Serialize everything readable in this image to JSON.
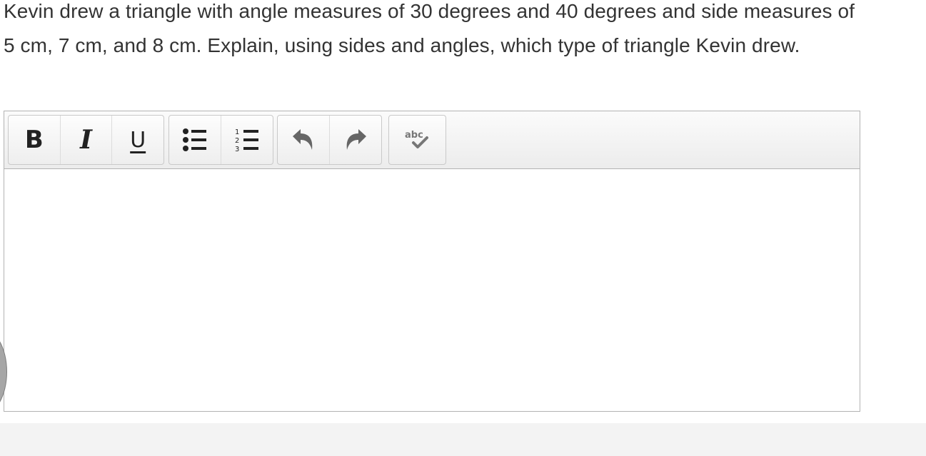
{
  "question": {
    "text": "Kevin drew a triangle with angle measures of 30 degrees and 40 degrees and side measures of 5 cm, 7 cm, and 8 cm. Explain, using sides and angles, which type of triangle Kevin drew."
  },
  "toolbar": {
    "bold_label": "B",
    "italic_label": "I",
    "underline_label": "U",
    "spellcheck_label": "abc",
    "icons": [
      "bold-icon",
      "italic-icon",
      "underline-icon",
      "bulleted-list-icon",
      "numbered-list-icon",
      "undo-icon",
      "redo-icon",
      "spellcheck-icon"
    ]
  },
  "editor": {
    "value": ""
  },
  "colors": {
    "text": "#333333",
    "toolbar_icon": "#222222",
    "muted_icon": "#777777",
    "border": "#b3b3b3"
  }
}
